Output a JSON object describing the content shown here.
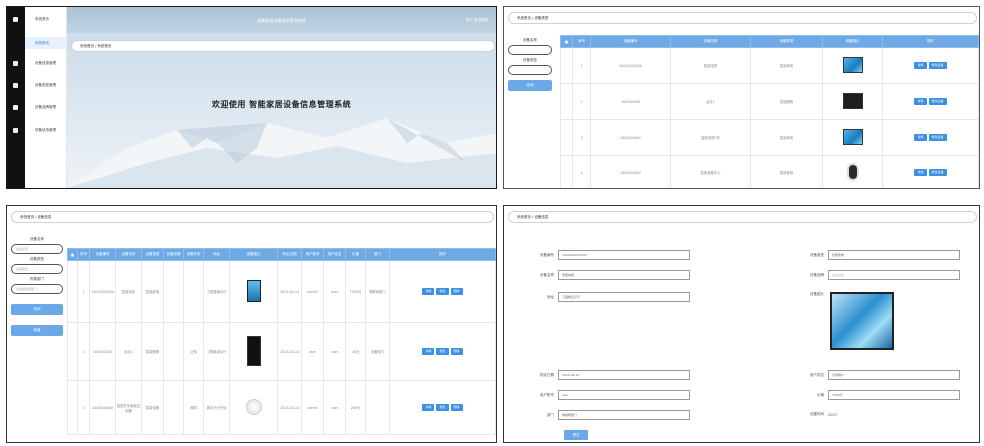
{
  "panel1": {
    "app_title": "智能家居设备信息管理系统",
    "user_info": "用户 退出登录",
    "logo_text": "系统首页",
    "menu": [
      {
        "label": "系统首页",
        "active": true
      },
      {
        "label": "设备信息管理",
        "active": false
      },
      {
        "label": "设备类型管理",
        "active": false
      },
      {
        "label": "设备品牌管理",
        "active": false
      },
      {
        "label": "设备状态管理",
        "active": false
      }
    ],
    "breadcrumb": "系统首页 / 系统首页",
    "welcome": "欢迎使用 智能家居设备信息管理系统"
  },
  "panel2": {
    "breadcrumb": "系统首页 / 设备类型",
    "filter_label_1": "设备名称",
    "filter_label_2": "设备类型",
    "search_label": "查询",
    "headers": [
      "",
      "序号",
      "设备编号",
      "设备名称",
      "设备类型",
      "设备图片",
      "操作"
    ],
    "rows": [
      {
        "no": "1",
        "code": "10010020030",
        "name": "智能电视",
        "type": "智能家电",
        "img": "tv",
        "actions": [
          "详情",
          "修改设备"
        ]
      },
      {
        "no": "2",
        "code": "100200300",
        "name": "台灯1",
        "type": "智能照明",
        "img": "dark",
        "actions": [
          "详情",
          "修改设备"
        ]
      },
      {
        "no": "3",
        "code": "1002003001",
        "name": "智能电视2号",
        "type": "智能家电",
        "img": "tv",
        "actions": [
          "详情",
          "修改设备"
        ]
      },
      {
        "no": "4",
        "code": "1002003002",
        "name": "智能音箱中心",
        "type": "智能音响",
        "img": "speaker",
        "actions": [
          "详情",
          "修改设备"
        ]
      }
    ]
  },
  "panel3": {
    "breadcrumb": "系统首页 / 设备信息",
    "filter_label_1": "设备名称",
    "filter_placeholder_1": "设备名称",
    "filter_label_2": "设备类型",
    "filter_placeholder_2": "设备类型",
    "filter_label_3": "所属部门",
    "filter_placeholder_3": "请选择所属部门",
    "search_label": "查询",
    "add_label": "新增",
    "headers": [
      "",
      "序号",
      "设备编号",
      "设备名称",
      "设备类型",
      "设备品牌",
      "设备状态",
      "地址",
      "设备图片",
      "购买日期",
      "用户账号",
      "用户姓名",
      "价格",
      "部门",
      "操作"
    ],
    "rows": [
      {
        "no": "1",
        "code": "10010020030",
        "name": "智能电视",
        "type": "智能家电",
        "brand": "",
        "status": "",
        "addr": "工程楼演示厅",
        "img": "tv",
        "date": "2023-04-10",
        "account": "admin",
        "uname": "user",
        "price": "7000元",
        "dept": "物联网部门",
        "actions": [
          "详情",
          "修改",
          "删除"
        ]
      },
      {
        "no": "2",
        "code": "100200300",
        "name": "台灯1",
        "type": "智能照明",
        "brand": "",
        "status": "正常",
        "addr": "工程楼演示厅",
        "img": "lamp",
        "date": "2023-04-10",
        "account": "user",
        "uname": "user",
        "price": "30元",
        "dept": "设备部门",
        "actions": [
          "详情",
          "修改",
          "删除"
        ]
      },
      {
        "no": "3",
        "code": "1000000000",
        "name": "智能开关面板控制器",
        "type": "智能电器",
        "brand": "",
        "status": "故障",
        "addr": "展示厅大厅处",
        "img": "round",
        "date": "2023-04-10",
        "account": "admin",
        "uname": "user",
        "price": "200元",
        "dept": "",
        "actions": [
          "详情",
          "修改",
          "删除"
        ]
      }
    ]
  },
  "panel4": {
    "breadcrumb": "系统首页 / 设备信息",
    "fields_left": [
      {
        "label": "设备编号",
        "value": "1001002003003",
        "placeholder": false
      },
      {
        "label": "设备名称",
        "value": "智能电视",
        "placeholder": false
      },
      {
        "label": "地址",
        "value": "工程楼演示厅",
        "placeholder": false
      }
    ],
    "fields_right": [
      {
        "label": "设备类型",
        "value": "智能家电",
        "placeholder": false
      },
      {
        "label": "设备品牌",
        "value": "设备品牌",
        "placeholder": true
      }
    ],
    "image_label": "设备图片",
    "fields_left_2": [
      {
        "label": "购买日期",
        "value": "2023-04-10"
      },
      {
        "label": "用户账号",
        "value": "user"
      },
      {
        "label": "部门",
        "value": "物联网部门"
      }
    ],
    "fields_right_2": [
      {
        "label": "用户姓名",
        "value": "示例用户"
      },
      {
        "label": "价格",
        "value": "7000元"
      }
    ],
    "create_time_label": "创建时间",
    "create_time_value": "2023",
    "submit_label": "提交"
  }
}
